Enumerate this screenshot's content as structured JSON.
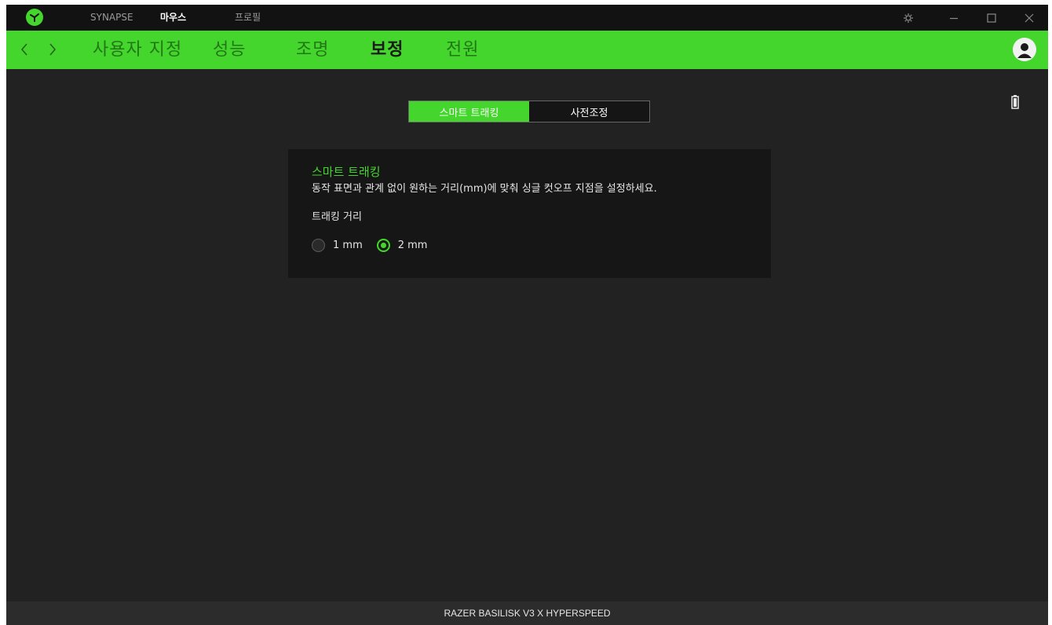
{
  "titlebar": {
    "tabs": [
      {
        "label": "SYNAPSE",
        "active": false
      },
      {
        "label": "마우스",
        "active": true
      },
      {
        "label": "프로필",
        "active": false
      }
    ]
  },
  "subnav": {
    "tabs": [
      {
        "label": "사용자 지정",
        "active": false
      },
      {
        "label": "성능",
        "active": false
      },
      {
        "label": "조명",
        "active": false
      },
      {
        "label": "보정",
        "active": true
      },
      {
        "label": "전원",
        "active": false
      }
    ]
  },
  "segment": {
    "options": [
      {
        "label": "스마트 트래킹",
        "active": true
      },
      {
        "label": "사전조정",
        "active": false
      }
    ]
  },
  "card": {
    "title": "스마트 트래킹",
    "description": "동작 표면과 관계 없이 원하는 거리(mm)에 맞춰 싱글 컷오프 지점을 설정하세요.",
    "distance_label": "트래킹 거리",
    "options": [
      {
        "label": "1 mm",
        "selected": false
      },
      {
        "label": "2 mm",
        "selected": true
      }
    ]
  },
  "footer": {
    "device_name": "RAZER BASILISK V3 X HYPERSPEED"
  },
  "colors": {
    "accent": "#44d62c",
    "background": "#222222",
    "titlebar": "#121212",
    "card": "#161616"
  }
}
